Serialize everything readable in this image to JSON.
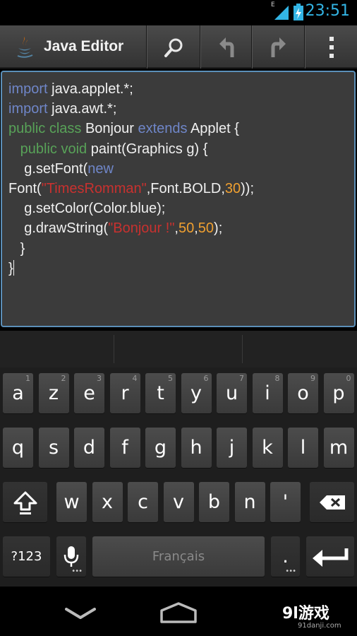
{
  "status_bar": {
    "time": "23:51",
    "network": "E"
  },
  "action_bar": {
    "title": "Java Editor",
    "icons": [
      "java-app-icon",
      "search-icon",
      "undo-icon",
      "redo-icon",
      "overflow-menu-icon"
    ]
  },
  "editor": {
    "lines": [
      [
        {
          "t": "import",
          "c": "kw"
        },
        {
          "t": " java.applet.*;",
          "c": ""
        }
      ],
      [
        {
          "t": "import",
          "c": "kw"
        },
        {
          "t": " java.awt.*;",
          "c": ""
        }
      ],
      [
        {
          "t": "public class",
          "c": "kw2"
        },
        {
          "t": " Bonjour ",
          "c": ""
        },
        {
          "t": "extends",
          "c": "kw"
        },
        {
          "t": " Applet {",
          "c": ""
        }
      ],
      [
        {
          "t": "   ",
          "c": ""
        },
        {
          "t": "public void",
          "c": "kw2"
        },
        {
          "t": " paint(Graphics g) {",
          "c": ""
        }
      ],
      [
        {
          "t": "    g.setFont(",
          "c": ""
        },
        {
          "t": "new",
          "c": "kw"
        }
      ],
      [
        {
          "t": "Font(",
          "c": ""
        },
        {
          "t": "\"TimesRomman\"",
          "c": "str"
        },
        {
          "t": ",Font.BOLD,",
          "c": ""
        },
        {
          "t": "30",
          "c": "num"
        },
        {
          "t": "));",
          "c": ""
        }
      ],
      [
        {
          "t": "    g.setColor(Color.blue);",
          "c": ""
        }
      ],
      [
        {
          "t": "    g.drawString(",
          "c": ""
        },
        {
          "t": "\"Bonjour !\"",
          "c": "str"
        },
        {
          "t": ",",
          "c": ""
        },
        {
          "t": "50",
          "c": "num"
        },
        {
          "t": ",",
          "c": ""
        },
        {
          "t": "50",
          "c": "num"
        },
        {
          "t": ");",
          "c": ""
        }
      ],
      [
        {
          "t": "   }",
          "c": ""
        }
      ],
      [
        {
          "t": "}",
          "c": ""
        }
      ]
    ],
    "colors": {
      "keyword": "#6f86c8",
      "modifier": "#58a258",
      "string": "#c8312f",
      "number": "#f0a030",
      "text": "#f0f0f0"
    }
  },
  "keyboard": {
    "row1": [
      {
        "k": "a",
        "h": "1"
      },
      {
        "k": "z",
        "h": "2"
      },
      {
        "k": "e",
        "h": "3"
      },
      {
        "k": "r",
        "h": "4"
      },
      {
        "k": "t",
        "h": "5"
      },
      {
        "k": "y",
        "h": "6"
      },
      {
        "k": "u",
        "h": "7"
      },
      {
        "k": "i",
        "h": "8"
      },
      {
        "k": "o",
        "h": "9"
      },
      {
        "k": "p",
        "h": "0"
      }
    ],
    "row2": [
      "q",
      "s",
      "d",
      "f",
      "g",
      "h",
      "j",
      "k",
      "l",
      "m"
    ],
    "row3": [
      "w",
      "x",
      "c",
      "v",
      "b",
      "n",
      "'"
    ],
    "sym_label": "?123",
    "space_label": "Français",
    "period_label": ".",
    "icons": [
      "shift-icon",
      "backspace-icon",
      "microphone-icon",
      "enter-icon"
    ]
  },
  "nav_bar": {
    "icons": [
      "back-icon",
      "home-icon"
    ],
    "watermark": "9l游戏",
    "watermark_url": "91danji.com"
  }
}
